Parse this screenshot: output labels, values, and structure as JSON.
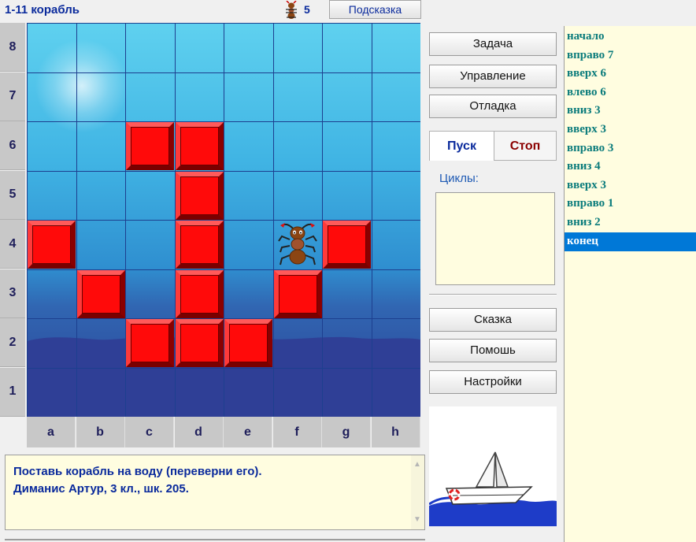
{
  "header": {
    "title": "1-11 корабль",
    "ant_count": "5",
    "hint_label": "Подсказка"
  },
  "board": {
    "row_labels": [
      "8",
      "7",
      "6",
      "5",
      "4",
      "3",
      "2",
      "1"
    ],
    "col_labels": [
      "a",
      "b",
      "c",
      "d",
      "e",
      "f",
      "g",
      "h"
    ],
    "blocks": [
      "c6",
      "d6",
      "d5",
      "a4",
      "d4",
      "g4",
      "b3",
      "d3",
      "f3",
      "c2",
      "d2",
      "e2"
    ],
    "ant_position": "f4",
    "block_color": "#ff0a0a",
    "water_color": "#2f3f96"
  },
  "controls": {
    "task": "Задача",
    "control": "Управление",
    "debug": "Отладка",
    "run": "Пуск",
    "stop": "Стоп",
    "cycles_label": "Циклы:",
    "tale": "Сказка",
    "help": "Помошь",
    "settings": "Настройки"
  },
  "program": {
    "commands": [
      "начало",
      "вправо 7",
      "вверх 6",
      "влево 6",
      "вниз 3",
      "вверх 3",
      "вправо 3",
      "вниз 4",
      "вверх 3",
      "вправо 1",
      "вниз 2",
      "конец"
    ],
    "selected_index": 11
  },
  "message": {
    "line1": "Поставь корабль на воду (переверни его).",
    "line2": "Диманис  Артур, 3 кл., шк. 205."
  },
  "icons": {
    "counter": "ant-icon",
    "picture": "sailboat-picture"
  }
}
